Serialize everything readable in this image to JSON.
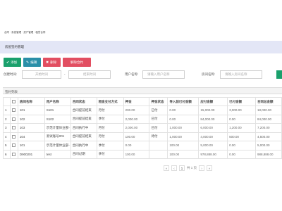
{
  "header": {
    "tiny_text": "合同 · 系统管理 · 资产管理 · 租赁合同"
  },
  "breadcrumb": {
    "title": "房屋签约管理"
  },
  "toolbar": {
    "add_label": "添加",
    "edit_label": "编辑",
    "delete_label": "删除",
    "terminate_label": "解除合约"
  },
  "filters": {
    "created_label": "创建时间:",
    "start_placeholder": "开始时间",
    "to": "-",
    "end_placeholder": "结束时间",
    "user_label": "用户名称:",
    "user_placeholder": "请输入用户名称",
    "room_label": "房间名称:",
    "room_placeholder": "请输入房间名称"
  },
  "list": {
    "title": "签约列表",
    "columns": [
      "",
      "房间名称",
      "用户名称",
      "合同状态",
      "租金支付方式",
      "押金",
      "押金状态",
      "导入前已付金额",
      "应付金额",
      "已付金额",
      "合同总金额"
    ],
    "rows": [
      {
        "idx": "1",
        "room": "101",
        "user": "S101",
        "status": "合同提前结束",
        "pay": "月付",
        "deposit": "200.00",
        "dstatus": "已付",
        "prepaid": "0.00",
        "due": "15,000.00",
        "paid": "3,000.00",
        "total": "18,000.00"
      },
      {
        "idx": "2",
        "room": "102",
        "user": "S102",
        "status": "合同提前结束",
        "pay": "季付",
        "deposit": "2,000.00",
        "dstatus": "已付",
        "prepaid": "0.00",
        "due": "84,000.00",
        "paid": "0.00",
        "total": "84,000.00"
      },
      {
        "idx": "3",
        "room": "103",
        "user": "示范计量体业部-",
        "status": "合同执行中",
        "pay": "月付",
        "deposit": "2,000.00",
        "dstatus": "已付",
        "prepaid": "1,000.00",
        "due": "6,000.00",
        "paid": "1,200.00",
        "total": "7,200.00"
      },
      {
        "idx": "4",
        "room": "104",
        "user": "测试账号001",
        "status": "合同提前结束",
        "pay": "月付",
        "deposit": "100.00",
        "dstatus": "待付",
        "prepaid": "1,000.00",
        "due": "4,000.00",
        "paid": "500.00",
        "total": "4,500.00"
      },
      {
        "idx": "5",
        "room": "101",
        "user": "示范计量体业部-",
        "status": "合同执行中",
        "pay": "季付",
        "deposit": "0.00",
        "dstatus": "",
        "prepaid": "100.00",
        "due": "5,000.00",
        "paid": "0.00",
        "total": "5,000.00"
      },
      {
        "idx": "6",
        "room": "D900201",
        "user": "test",
        "status": "合同过期",
        "pay": "季付",
        "deposit": "100.00",
        "dstatus": "",
        "prepaid": "100.00",
        "due": "978,888.00",
        "paid": "0.00",
        "total": "988,888.00"
      }
    ]
  },
  "pager": {
    "first": "«",
    "prev": "‹",
    "page": "1",
    "total_text": "共 1 页",
    "next": "›",
    "last": "»"
  }
}
